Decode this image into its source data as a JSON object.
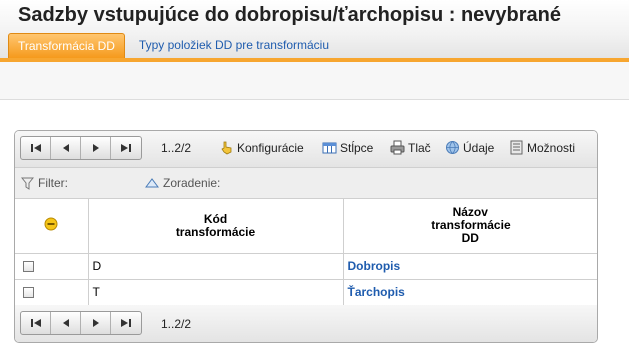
{
  "page": {
    "title": "Sadzby vstupujúce do dobropisu/ťarchopisu :  nevybrané"
  },
  "tabs": [
    {
      "label": "Transformácia DD",
      "active": true
    },
    {
      "label": "Typy položiek DD pre transformáciu",
      "active": false
    }
  ],
  "toolbar": {
    "range": "1..2/2",
    "config_label": "Konfigurácie",
    "columns_label": "Stĺpce",
    "print_label": "Tlač",
    "data_label": "Údaje",
    "options_label": "Možnosti"
  },
  "filterbar": {
    "filter_label": "Filter:",
    "sort_label": "Zoradenie:"
  },
  "table": {
    "headers": {
      "code": "Kód transformácie",
      "name": "Názov transformácie DD"
    },
    "rows": [
      {
        "code": "D",
        "name": "Dobropis"
      },
      {
        "code": "T",
        "name": "Ťarchopis"
      }
    ]
  },
  "footer": {
    "range": "1..2/2"
  },
  "colors": {
    "accent": "#f7a630",
    "link": "#1f5cae"
  }
}
